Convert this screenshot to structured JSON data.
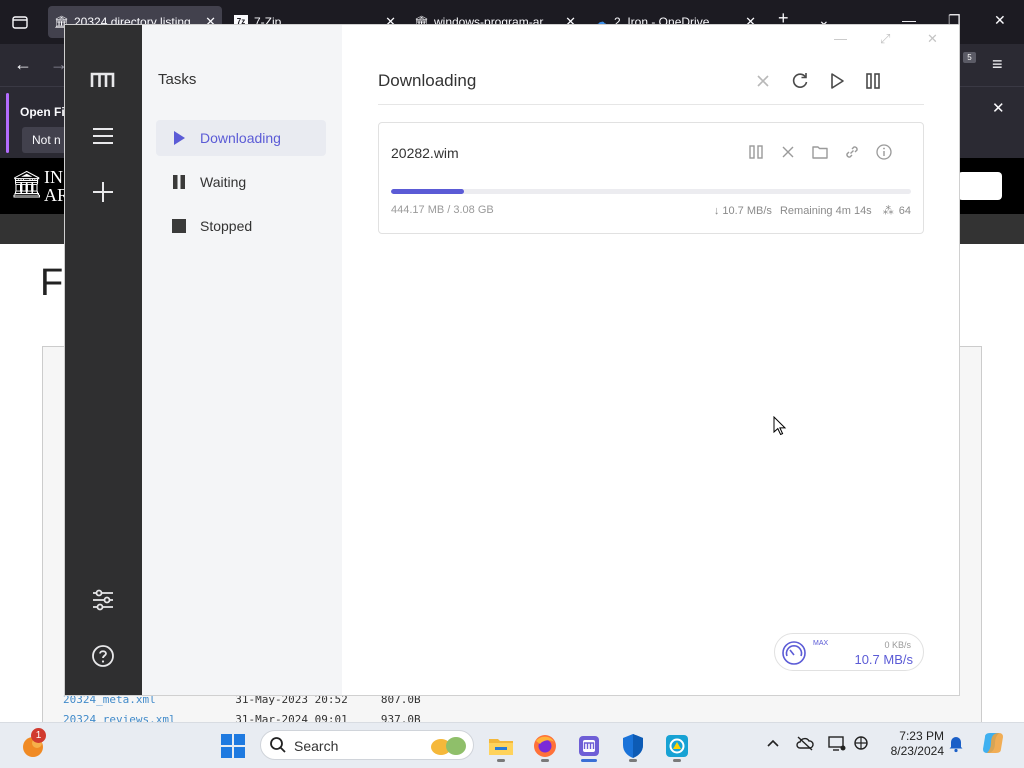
{
  "browser": {
    "tabs": [
      {
        "label": "20324 directory listing",
        "active": true
      },
      {
        "label": "7-Zip"
      },
      {
        "label": "windows-program-ar"
      },
      {
        "label": "2. Iron - OneDrive"
      }
    ],
    "extension_badge": "5",
    "infobar": {
      "open_label": "Open Fi",
      "not_now_label": "Not n"
    },
    "site_brand_line1": "IN",
    "site_brand_line2": "AR",
    "page_heading": "F",
    "listing": [
      {
        "name": "20324_meta.xml",
        "date": "31-May-2023 20:52",
        "size": "807.0B"
      },
      {
        "name": "20324_reviews.xml",
        "date": "31-Mar-2024 09:01",
        "size": "937.0B"
      }
    ]
  },
  "motrix": {
    "subnav_title": "Tasks",
    "nav_items": [
      {
        "label": "Downloading",
        "icon": "play-icon",
        "active": true
      },
      {
        "label": "Waiting",
        "icon": "pause-icon"
      },
      {
        "label": "Stopped",
        "icon": "stop-icon"
      }
    ],
    "main_title": "Downloading",
    "task": {
      "name": "20282.wim",
      "progress": 0.14,
      "size_text": "444.17 MB / 3.08 GB",
      "speed": "↓ 10.7 MB/s",
      "remaining": "Remaining 4m 14s",
      "connections": "64"
    },
    "speedometer": {
      "mode": "MAX",
      "upload": "0 KB/s",
      "download": "10.7 MB/s"
    }
  },
  "taskbar": {
    "notification_count": "1",
    "search_placeholder": "Search",
    "time": "7:23 PM",
    "date": "8/23/2024"
  },
  "colors": {
    "accent": "#5b5bd6",
    "sidebar": "#2f2f30",
    "subnav": "#f4f5f7"
  }
}
